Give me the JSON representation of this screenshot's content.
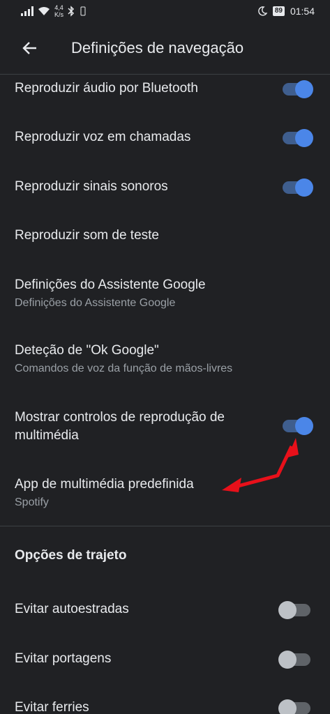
{
  "status": {
    "speed_top": "4,4",
    "speed_bottom": "K/s",
    "battery": "89",
    "time": "01:54"
  },
  "header": {
    "title": "Definições de navegação"
  },
  "settings": [
    {
      "title": "Reproduzir áudio por Bluetooth",
      "toggle": "on"
    },
    {
      "title": "Reproduzir voz em chamadas",
      "toggle": "on"
    },
    {
      "title": "Reproduzir sinais sonoros",
      "toggle": "on"
    },
    {
      "title": "Reproduzir som de teste"
    },
    {
      "title": "Definições do Assistente Google",
      "subtitle": "Definições do Assistente Google"
    },
    {
      "title": "Deteção de \"Ok Google\"",
      "subtitle": "Comandos de voz da função de mãos-livres"
    },
    {
      "title_line1": "Mostrar controlos de reprodução de",
      "title_line2": "multimédia",
      "toggle": "on"
    },
    {
      "title": "App de multimédia predefinida",
      "subtitle": "Spotify"
    }
  ],
  "route_section": {
    "heading": "Opções de trajeto",
    "items": [
      {
        "title": "Evitar autoestradas",
        "toggle": "off"
      },
      {
        "title": "Evitar portagens",
        "toggle": "off"
      },
      {
        "title": "Evitar ferries",
        "toggle": "off"
      }
    ]
  },
  "colors": {
    "background": "#202124",
    "toggle_on": "#4b86e8",
    "annotation_arrow": "#e8101a"
  }
}
